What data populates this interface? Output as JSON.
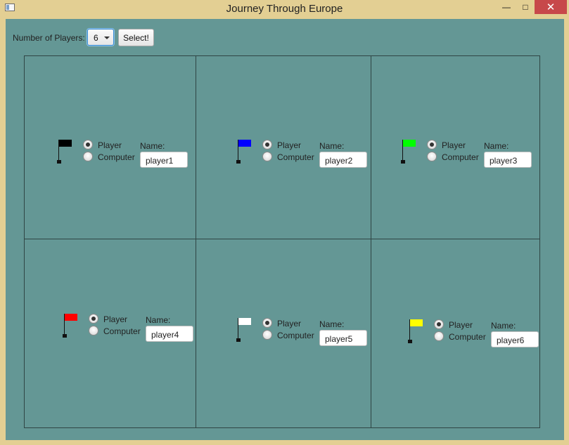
{
  "window": {
    "title": "Journey Through Europe",
    "minimize": "—",
    "maximize": "□",
    "close": "✕"
  },
  "toolbar": {
    "label": "Number of Players:",
    "select_value": "6",
    "select_button": "Select!"
  },
  "players": [
    {
      "flag_color": "#000000",
      "player_label": "Player",
      "computer_label": "Computer",
      "selected": "Player",
      "name_label": "Name:",
      "name_value": "player1"
    },
    {
      "flag_color": "#0000ff",
      "player_label": "Player",
      "computer_label": "Computer",
      "selected": "Player",
      "name_label": "Name:",
      "name_value": "player2"
    },
    {
      "flag_color": "#00ff00",
      "player_label": "Player",
      "computer_label": "Computer",
      "selected": "Player",
      "name_label": "Name:",
      "name_value": "player3"
    },
    {
      "flag_color": "#ff0000",
      "player_label": "Player",
      "computer_label": "Computer",
      "selected": "Player",
      "name_label": "Name:",
      "name_value": "player4"
    },
    {
      "flag_color": "#ffffff",
      "player_label": "Player",
      "computer_label": "Computer",
      "selected": "Player",
      "name_label": "Name:",
      "name_value": "player5"
    },
    {
      "flag_color": "#ffff00",
      "player_label": "Player",
      "computer_label": "Computer",
      "selected": "Player",
      "name_label": "Name:",
      "name_value": "player6"
    }
  ]
}
